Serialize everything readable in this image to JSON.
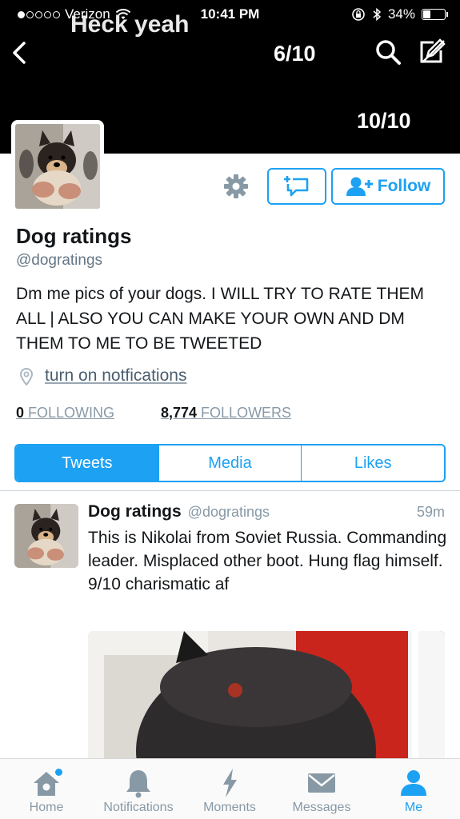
{
  "status_bar": {
    "carrier": "Verizon",
    "time": "10:41 PM",
    "battery": "34%",
    "battery_level": 0.34
  },
  "header": {
    "overlay_text": "Heck yeah",
    "tweet_count": "6/10",
    "banner_rating": "10/10"
  },
  "profile": {
    "name": "Dog ratings",
    "handle": "@dogratings",
    "bio": "Dm me pics of your dogs. I WILL TRY TO RATE THEM ALL | ALSO YOU CAN MAKE YOUR OWN AND DM THEM TO ME TO BE TWEETED",
    "location": "turn on notfications",
    "following_count": "0",
    "following_label": " FOLLOWING",
    "followers_count": "8,774",
    "followers_label": " FOLLOWERS",
    "follow_label": "Follow"
  },
  "tabs": [
    {
      "label": "Tweets",
      "active": true
    },
    {
      "label": "Media",
      "active": false
    },
    {
      "label": "Likes",
      "active": false
    }
  ],
  "tweet": {
    "name": "Dog ratings",
    "handle": "@dogratings",
    "time": "59m",
    "text": "This is Nikolai from Soviet Russia. Commanding leader. Misplaced other boot. Hung flag himself. 9/10 charismatic af"
  },
  "tab_bar": [
    {
      "label": "Home",
      "icon": "home-icon",
      "active": false
    },
    {
      "label": "Notifications",
      "icon": "bell-icon",
      "active": false
    },
    {
      "label": "Moments",
      "icon": "lightning-icon",
      "active": false
    },
    {
      "label": "Messages",
      "icon": "envelope-icon",
      "active": false
    },
    {
      "label": "Me",
      "icon": "person-icon",
      "active": true
    }
  ],
  "colors": {
    "accent": "#1da1f2",
    "banner": "#000000",
    "muted": "#8899a6"
  }
}
